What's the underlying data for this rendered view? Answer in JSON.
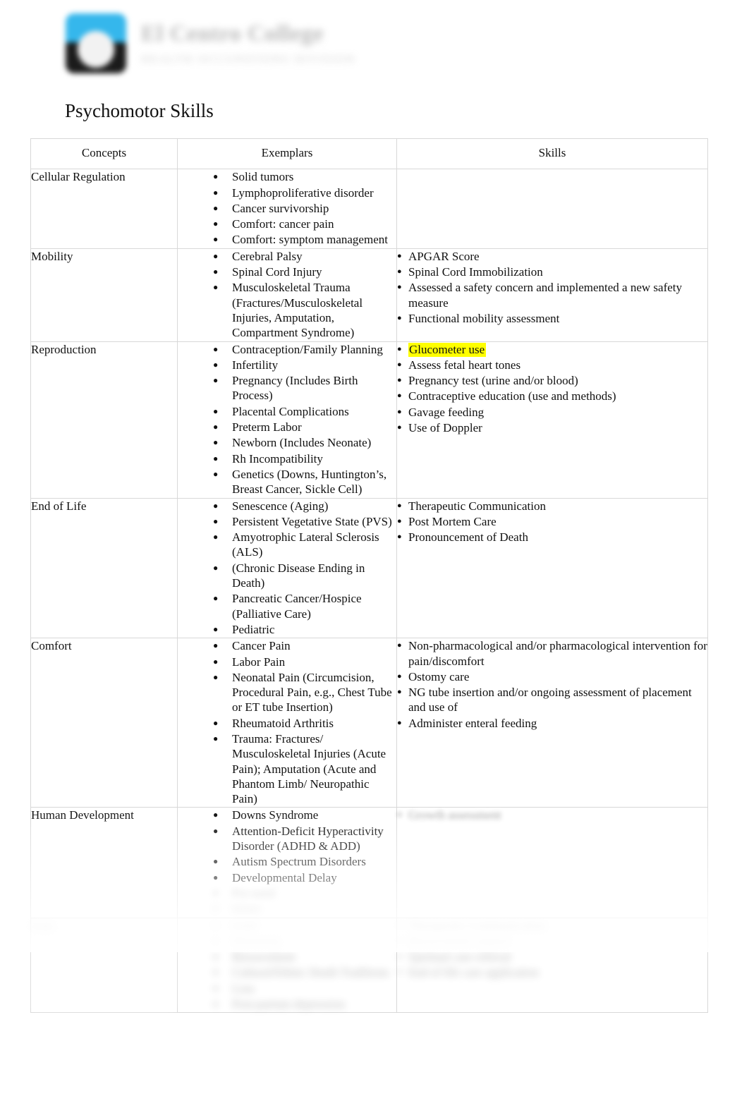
{
  "letterhead": {
    "institution_name": "El Centro College",
    "institution_subtitle": "HEALTH OCCUPATIONS DIVISION",
    "logo_icon": "college-logo-icon"
  },
  "document": {
    "title": "Psychomotor Skills"
  },
  "table": {
    "headers": {
      "concepts": "Concepts",
      "exemplars": "Exemplars",
      "skills": "Skills"
    },
    "rows": [
      {
        "concept": "Cellular Regulation",
        "exemplars": [
          "Solid tumors",
          "Lymphoproliferative disorder",
          "Cancer survivorship",
          "Comfort: cancer pain",
          "Comfort: symptom management"
        ],
        "skills": []
      },
      {
        "concept": "Mobility",
        "exemplars": [
          "Cerebral Palsy",
          "Spinal Cord Injury",
          "Musculoskeletal Trauma (Fractures/Musculoskeletal Injuries, Amputation, Compartment Syndrome)"
        ],
        "skills": [
          "APGAR Score",
          "Spinal Cord Immobilization",
          "Assessed a safety concern and implemented a new   safety measure",
          "Functional mobility assessment"
        ]
      },
      {
        "concept": "Reproduction",
        "exemplars": [
          "Contraception/Family Planning",
          "Infertility",
          "Pregnancy (Includes Birth Process)",
          "Placental Complications",
          "Preterm Labor",
          "Newborn (Includes Neonate)",
          "Rh Incompatibility",
          "Genetics (Downs, Huntington’s, Breast Cancer, Sickle Cell)"
        ],
        "skills": [
          "Glucometer use",
          "Assess fetal heart tones",
          "Pregnancy test (urine and/or blood)",
          "Contraceptive education (use and methods)",
          "Gavage feeding",
          "Use of Doppler"
        ],
        "highlighted_skill": "Glucometer use",
        "highlight_color": "#ffff00"
      },
      {
        "concept": "End of Life",
        "exemplars": [
          "Senescence (Aging)",
          "Persistent Vegetative State (PVS)",
          "Amyotrophic Lateral Sclerosis (ALS)",
          "(Chronic Disease Ending in Death)",
          "Pancreatic Cancer/Hospice (Palliative Care)",
          "Pediatric"
        ],
        "skills": [
          "Therapeutic Communication",
          "Post Mortem Care",
          "Pronouncement of Death"
        ]
      },
      {
        "concept": "Comfort",
        "exemplars": [
          "Cancer Pain",
          "Labor Pain",
          "Neonatal Pain (Circumcision, Procedural Pain, e.g., Chest Tube or ET tube Insertion)",
          "Rheumatoid Arthritis",
          "Trauma:  Fractures/ Musculoskeletal Injuries (Acute Pain); Amputation (Acute and Phantom Limb/ Neuropathic Pain)"
        ],
        "skills": [
          "Non-pharmacological and/or pharmacological intervention for pain/discomfort",
          "Ostomy care",
          "NG tube insertion and/or ongoing assessment of placement and use of",
          "Administer enteral feeding"
        ]
      },
      {
        "concept": "Human Development",
        "exemplars": [
          "Downs Syndrome",
          "Attention-Deficit Hyperactivity Disorder (ADHD & ADD)",
          "Autism Spectrum Disorders",
          "Developmental Delay"
        ],
        "exemplars_obscured": [
          "Pre-natal",
          "Infant",
          "Normal Stages of Growth"
        ],
        "skills_obscured": [
          "Growth assessment"
        ]
      },
      {
        "concept_obscured": "Loss",
        "exemplars_obscured": [
          "Grief",
          "Mourning",
          "Bereavement",
          "Cultural/Ethnic Death Traditions",
          "Loss",
          "Post-partum depression"
        ],
        "skills_obscured": [
          "Therapeutic Communication",
          "Bereavement support",
          "Spiritual care referral",
          "End of life care application"
        ]
      }
    ]
  }
}
